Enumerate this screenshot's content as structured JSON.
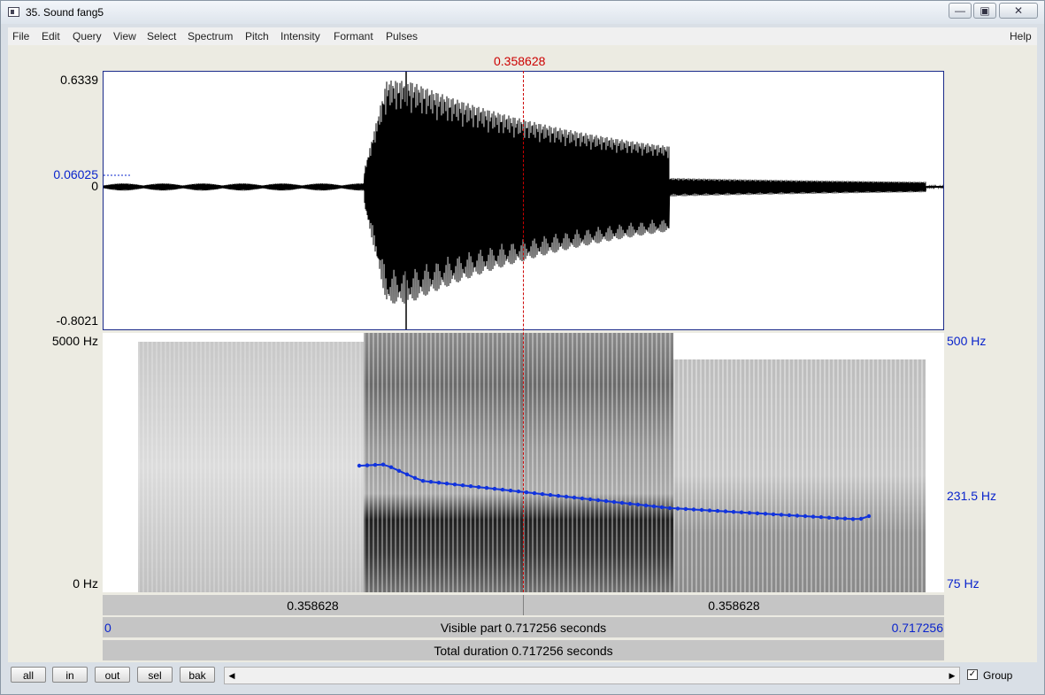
{
  "window": {
    "title": "35. Sound fang5"
  },
  "menu": {
    "items": [
      "File",
      "Edit",
      "Query",
      "View",
      "Select",
      "Spectrum",
      "Pitch",
      "Intensity",
      "Formant",
      "Pulses"
    ],
    "help": "Help"
  },
  "cursor": {
    "time_label": "0.358628"
  },
  "waveform": {
    "y_max": "0.6339",
    "y_marker": "0.06025",
    "y_zero": "0",
    "y_min": "-0.8021"
  },
  "spectrogram": {
    "freq_max": "5000 Hz",
    "freq_min": "0 Hz",
    "pitch_max": "500 Hz",
    "pitch_mid": "231.5 Hz",
    "pitch_min": "75 Hz",
    "pitch_color": "#1133dd"
  },
  "time_bar": {
    "left_segment": "0.358628",
    "right_segment": "0.358628",
    "window_start": "0",
    "visible_part": "Visible part 0.717256 seconds",
    "window_end": "0.717256",
    "total_duration": "Total duration 0.717256 seconds"
  },
  "buttons": {
    "all": "all",
    "in": "in",
    "out": "out",
    "sel": "sel",
    "bak": "bak"
  },
  "group": {
    "label": "Group",
    "checked": true
  }
}
